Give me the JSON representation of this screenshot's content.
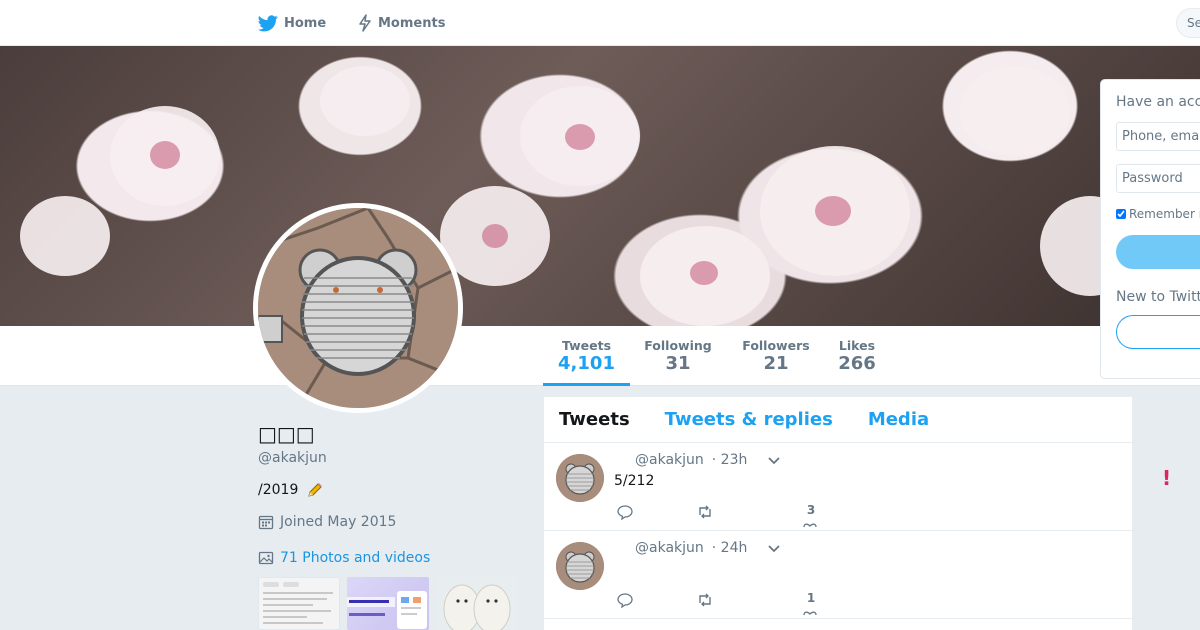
{
  "nav": {
    "home_label": "Home",
    "moments_label": "Moments",
    "search_placeholder": "Se"
  },
  "stats": [
    {
      "label": "Tweets",
      "value": "4,101"
    },
    {
      "label": "Following",
      "value": "31"
    },
    {
      "label": "Followers",
      "value": "21"
    },
    {
      "label": "Likes",
      "value": "266"
    }
  ],
  "login": {
    "title": "Have an acc",
    "phone_placeholder": "Phone, ema",
    "password_placeholder": "Password",
    "remember_label": "Remember r",
    "new_label": "New to Twitt"
  },
  "profile": {
    "name": "□□□",
    "handle": "@akakjun",
    "bio": "/2019",
    "joined": "Joined May 2015",
    "photos_link": "71 Photos and videos"
  },
  "timeline": {
    "tabs": [
      {
        "label": "Tweets"
      },
      {
        "label": "Tweets & replies"
      },
      {
        "label": "Media"
      }
    ],
    "tweets": [
      {
        "handle": "@akakjun",
        "time": "· 23h",
        "text": "5/212",
        "likes": "3"
      },
      {
        "handle": "@akakjun",
        "time": "· 24h",
        "text": "",
        "likes": "1"
      }
    ]
  },
  "alert_glyph": "!",
  "colors": {
    "accent": "#1da1f2",
    "link": "#1b95e0",
    "muted": "#657786",
    "alert": "#e0245e"
  }
}
